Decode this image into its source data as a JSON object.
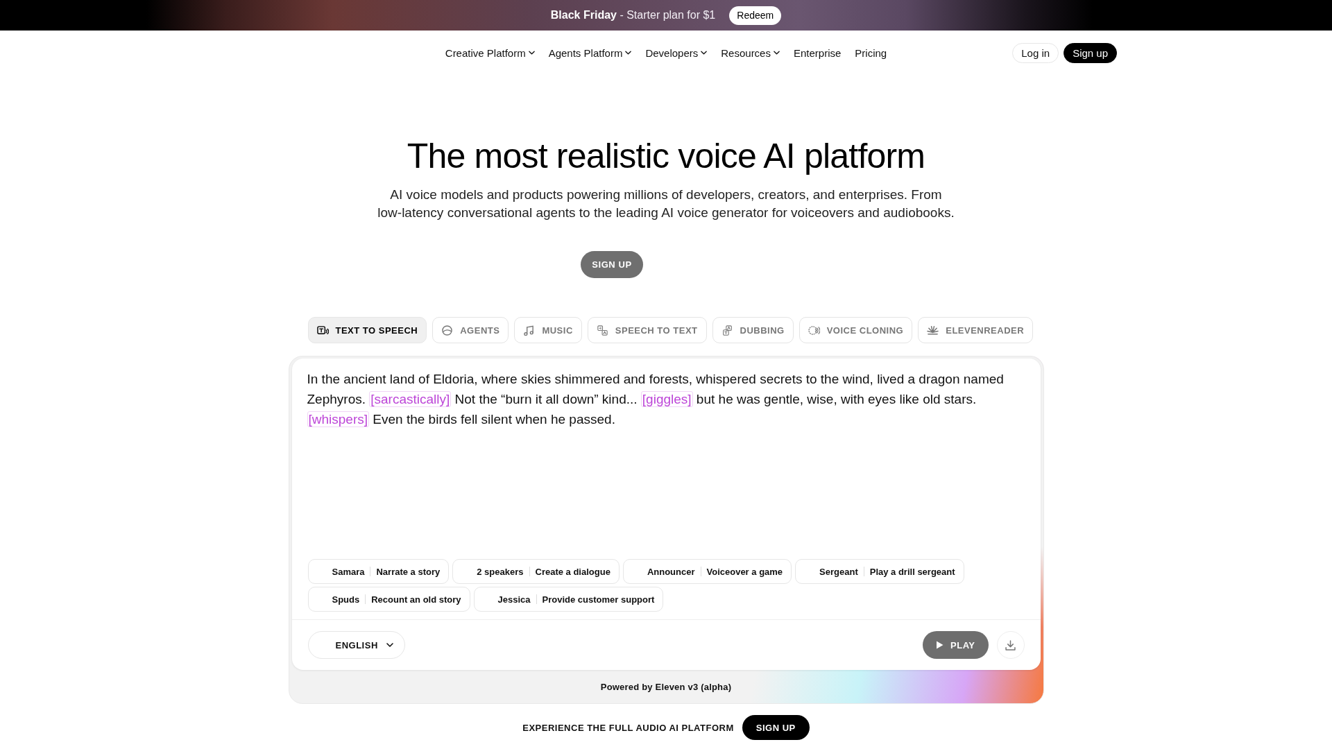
{
  "banner": {
    "text": "**Black Friday** - Starter plan for $1",
    "button": "Redeem"
  },
  "nav": {
    "items": [
      {
        "label": "Creative Platform",
        "dropdown": true
      },
      {
        "label": "Agents Platform",
        "dropdown": true
      },
      {
        "label": "Developers",
        "dropdown": true
      },
      {
        "label": "Resources",
        "dropdown": true
      },
      {
        "label": "Enterprise",
        "dropdown": false
      },
      {
        "label": "Pricing",
        "dropdown": false
      }
    ],
    "actions": [
      {
        "label": "Log in",
        "kind": "outline"
      },
      {
        "label": "Sign up",
        "kind": "filled"
      }
    ]
  },
  "hero": {
    "title": "The most realistic voice AI platform",
    "subtitle": "AI voice models and products powering millions of developers, creators, and enterprises. From low-latency conversational agents to the leading AI voice generator for voiceovers and audiobooks.",
    "button": "SIGN UP"
  },
  "demo": {
    "tabs": [
      {
        "label": "TEXT TO SPEECH",
        "selected": true
      },
      {
        "label": "AGENTS",
        "selected": false
      },
      {
        "label": "MUSIC",
        "selected": false
      },
      {
        "label": "SPEECH TO TEXT",
        "selected": false
      },
      {
        "label": "DUBBING",
        "selected": false
      },
      {
        "label": "VOICE CLONING",
        "selected": false
      },
      {
        "label": "ELEVENREADER",
        "selected": false
      }
    ],
    "editor": {
      "segments": [
        {
          "kind": "text",
          "text": "In the ancient land of Eldoria, where skies shimmered and forests, whispered secrets to the wind, lived a dragon named Zephyros. "
        },
        {
          "kind": "tag",
          "text": "[sarcastically]"
        },
        {
          "kind": "text",
          "text": " Not the “burn it all down” kind... "
        },
        {
          "kind": "tag",
          "text": "[giggles]"
        },
        {
          "kind": "text",
          "text": " but he was gentle, wise, with eyes like old stars. "
        },
        {
          "kind": "tag",
          "text": "[whispers]"
        },
        {
          "kind": "text",
          "text": " Even the birds fell silent when he passed."
        }
      ]
    },
    "voices": [
      {
        "name": "Samara",
        "action": "Narrate a story"
      },
      {
        "name": "2 speakers",
        "action": "Create a dialogue"
      },
      {
        "name": "Announcer",
        "action": "Voiceover a game"
      },
      {
        "name": "Sergeant",
        "action": "Play a drill sergeant"
      },
      {
        "name": "Spuds",
        "action": "Recount an old story"
      },
      {
        "name": "Jessica",
        "action": "Provide customer support"
      }
    ],
    "language": "ENGLISH",
    "play": "PLAY",
    "powered_by": "Powered by Eleven v3 (alpha)"
  },
  "cta": {
    "text": "EXPERIENCE THE FULL AUDIO AI PLATFORM",
    "button": "SIGN UP"
  }
}
